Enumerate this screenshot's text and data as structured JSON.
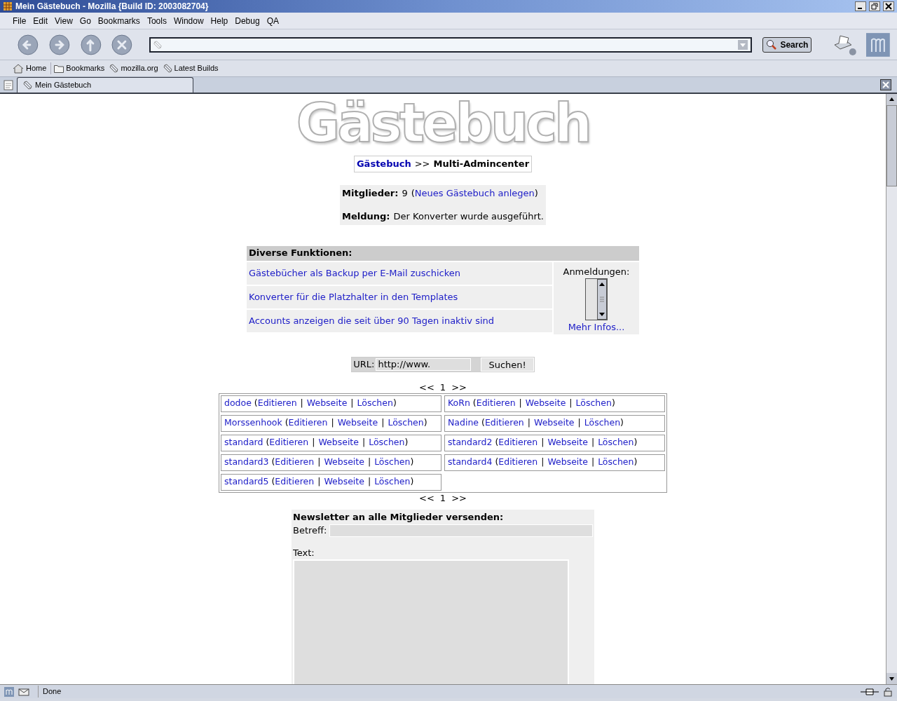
{
  "window": {
    "title": "Mein Gästebuch - Mozilla {Build ID: 2003082704}"
  },
  "menu": [
    "File",
    "Edit",
    "View",
    "Go",
    "Bookmarks",
    "Tools",
    "Window",
    "Help",
    "Debug",
    "QA"
  ],
  "search_button": "Search",
  "bookmarks": [
    {
      "label": "Home",
      "kind": "home"
    },
    {
      "label": "Bookmarks",
      "kind": "folder"
    },
    {
      "label": "mozilla.org",
      "kind": "link"
    },
    {
      "label": "Latest Builds",
      "kind": "link"
    }
  ],
  "tabs": [
    {
      "label": "Mein Gästebuch",
      "selected": true
    }
  ],
  "page": {
    "logo": "Gästebuch",
    "breadcrumb": {
      "link": "Gästebuch",
      "separator": ">>",
      "current": "Multi-Admincenter"
    },
    "stats": {
      "members_label": "Mitglieder:",
      "members_value": "9",
      "open": "(",
      "new_link": "Neues Gästebuch anlegen",
      "close": ")",
      "message_label": "Meldung:",
      "message": "Der Konverter wurde ausgeführt."
    },
    "functions": {
      "header": "Diverse Funktionen:",
      "links": [
        "Gästebücher als Backup per E-Mail zuschicken",
        "Konverter für die Platzhalter in den Templates",
        "Accounts anzeigen die seit über 90 Tagen inaktiv sind"
      ],
      "side_label": "Anmeldungen:",
      "more_link": "Mehr Infos..."
    },
    "url_form": {
      "label": "URL:",
      "value": "http://www.",
      "button": "Suchen!"
    },
    "pager_top": {
      "prev": "<<",
      "page": "1",
      "next": ">>"
    },
    "members": {
      "open": "(",
      "separator": "|",
      "close": ")",
      "items": [
        {
          "name": "dodoe",
          "actions": [
            "Editieren",
            "Webseite",
            "Löschen"
          ]
        },
        {
          "name": "KoRn",
          "actions": [
            "Editieren",
            "Webseite",
            "Löschen"
          ]
        },
        {
          "name": "Morssenhook",
          "actions": [
            "Editieren",
            "Webseite",
            "Löschen"
          ]
        },
        {
          "name": "Nadine",
          "actions": [
            "Editieren",
            "Webseite",
            "Löschen"
          ]
        },
        {
          "name": "standard",
          "actions": [
            "Editieren",
            "Webseite",
            "Löschen"
          ]
        },
        {
          "name": "standard2",
          "actions": [
            "Editieren",
            "Webseite",
            "Löschen"
          ]
        },
        {
          "name": "standard3",
          "actions": [
            "Editieren",
            "Webseite",
            "Löschen"
          ]
        },
        {
          "name": "standard4",
          "actions": [
            "Editieren",
            "Webseite",
            "Löschen"
          ]
        },
        {
          "name": "standard5",
          "actions": [
            "Editieren",
            "Webseite",
            "Löschen"
          ]
        }
      ]
    },
    "pager_bottom": {
      "prev": "<<",
      "page": "1",
      "next": ">>"
    },
    "newsletter": {
      "title": "Newsletter an alle Mitglieder versenden:",
      "subject_label": "Betreff:",
      "text_label": "Text:"
    }
  },
  "status_bar": {
    "text": "Done"
  }
}
